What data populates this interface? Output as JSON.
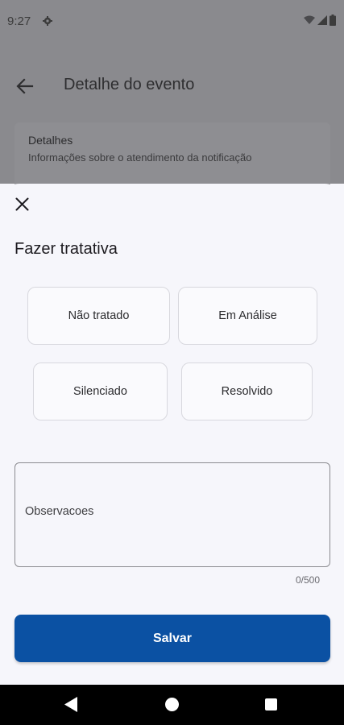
{
  "status_bar": {
    "time": "9:27"
  },
  "app_bar": {
    "title": "Detalhe do evento"
  },
  "background_card": {
    "title": "Detalhes",
    "subtitle": "Informações sobre o atendimento da notificação"
  },
  "sheet": {
    "title": "Fazer tratativa",
    "options": [
      {
        "label": "Não tratado"
      },
      {
        "label": "Em Análise"
      },
      {
        "label": "Silenciado"
      },
      {
        "label": "Resolvido"
      }
    ],
    "observations": {
      "placeholder": "Observacoes",
      "value": ""
    },
    "counter": "0/500",
    "save_label": "Salvar"
  },
  "colors": {
    "primary": "#0b51a3",
    "scrim": "#8a8a8e",
    "sheet_background": "#f6f6fb"
  }
}
